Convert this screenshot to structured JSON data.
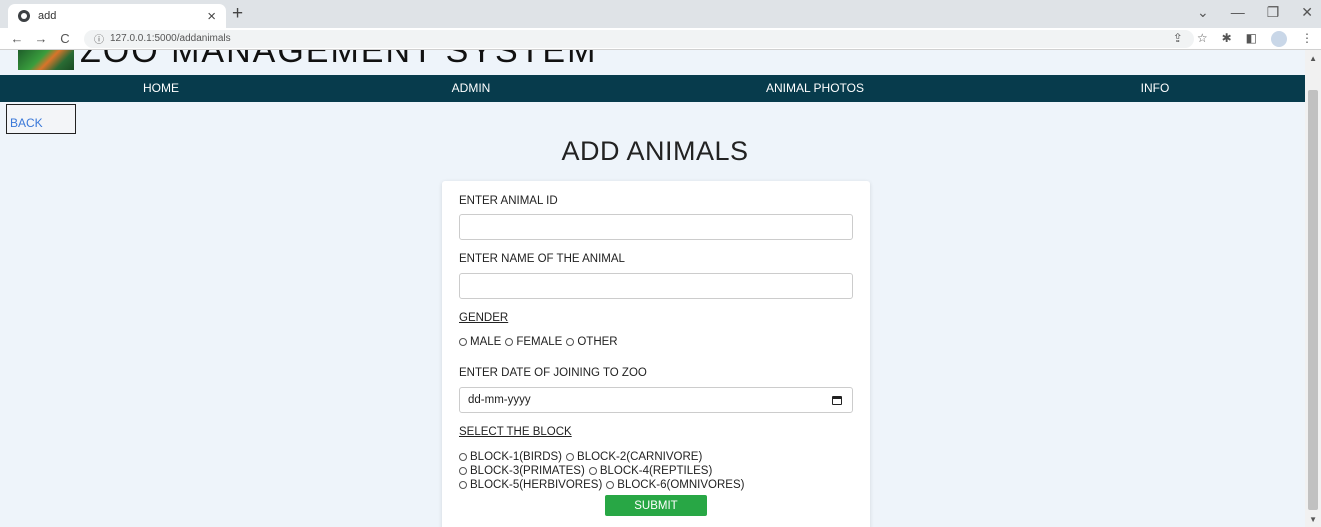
{
  "browser": {
    "tab_title": "add",
    "tab_close": "×",
    "new_tab": "+",
    "url": "127.0.0.1:5000/addanimals",
    "win_minimize": "—",
    "win_restore": "❐",
    "win_close": "✕",
    "win_down": "⌄"
  },
  "site": {
    "title": "ZOO MANAGEMENT SYSTEM"
  },
  "nav": {
    "home": "HOME",
    "admin": "ADMIN",
    "photos": "ANIMAL PHOTOS",
    "info": "INFO"
  },
  "back_label": "BACK",
  "heading": "ADD ANIMALS",
  "form": {
    "animal_id_label": "ENTER ANIMAL ID",
    "animal_id_value": "",
    "name_label": "ENTER NAME OF THE ANIMAL",
    "name_value": "",
    "gender_label": "GENDER",
    "gender_options": [
      "MALE",
      "FEMALE",
      "OTHER"
    ],
    "date_label": "ENTER DATE OF JOINING TO ZOO",
    "date_placeholder": "dd-mm-yyyy",
    "block_label": "SELECT THE BLOCK",
    "blocks": [
      "BLOCK-1(BIRDS)",
      "BLOCK-2(CARNIVORE)",
      "BLOCK-3(PRIMATES)",
      "BLOCK-4(REPTILES)",
      "BLOCK-5(HERBIVORES)",
      "BLOCK-6(OMNIVORES)"
    ],
    "submit_label": "SUBMIT"
  },
  "colors": {
    "navbar": "#073b4c",
    "submit": "#28a745",
    "back_text": "#3a78d8",
    "page_bg": "#eef4fa"
  }
}
